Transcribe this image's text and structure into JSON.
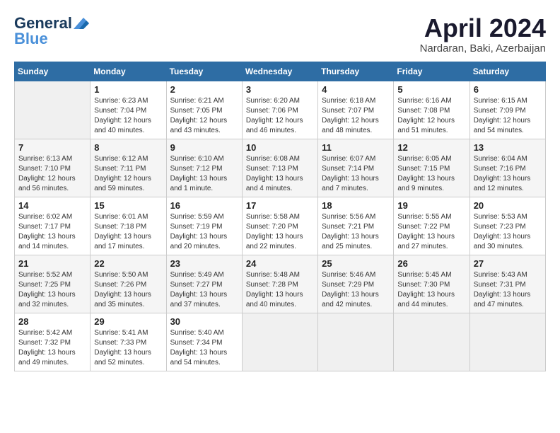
{
  "logo": {
    "line1": "General",
    "line2": "Blue"
  },
  "title": "April 2024",
  "location": "Nardaran, Baki, Azerbaijan",
  "days_of_week": [
    "Sunday",
    "Monday",
    "Tuesday",
    "Wednesday",
    "Thursday",
    "Friday",
    "Saturday"
  ],
  "weeks": [
    [
      {
        "day": "",
        "sunrise": "",
        "sunset": "",
        "daylight": ""
      },
      {
        "day": "1",
        "sunrise": "Sunrise: 6:23 AM",
        "sunset": "Sunset: 7:04 PM",
        "daylight": "Daylight: 12 hours and 40 minutes."
      },
      {
        "day": "2",
        "sunrise": "Sunrise: 6:21 AM",
        "sunset": "Sunset: 7:05 PM",
        "daylight": "Daylight: 12 hours and 43 minutes."
      },
      {
        "day": "3",
        "sunrise": "Sunrise: 6:20 AM",
        "sunset": "Sunset: 7:06 PM",
        "daylight": "Daylight: 12 hours and 46 minutes."
      },
      {
        "day": "4",
        "sunrise": "Sunrise: 6:18 AM",
        "sunset": "Sunset: 7:07 PM",
        "daylight": "Daylight: 12 hours and 48 minutes."
      },
      {
        "day": "5",
        "sunrise": "Sunrise: 6:16 AM",
        "sunset": "Sunset: 7:08 PM",
        "daylight": "Daylight: 12 hours and 51 minutes."
      },
      {
        "day": "6",
        "sunrise": "Sunrise: 6:15 AM",
        "sunset": "Sunset: 7:09 PM",
        "daylight": "Daylight: 12 hours and 54 minutes."
      }
    ],
    [
      {
        "day": "7",
        "sunrise": "Sunrise: 6:13 AM",
        "sunset": "Sunset: 7:10 PM",
        "daylight": "Daylight: 12 hours and 56 minutes."
      },
      {
        "day": "8",
        "sunrise": "Sunrise: 6:12 AM",
        "sunset": "Sunset: 7:11 PM",
        "daylight": "Daylight: 12 hours and 59 minutes."
      },
      {
        "day": "9",
        "sunrise": "Sunrise: 6:10 AM",
        "sunset": "Sunset: 7:12 PM",
        "daylight": "Daylight: 13 hours and 1 minute."
      },
      {
        "day": "10",
        "sunrise": "Sunrise: 6:08 AM",
        "sunset": "Sunset: 7:13 PM",
        "daylight": "Daylight: 13 hours and 4 minutes."
      },
      {
        "day": "11",
        "sunrise": "Sunrise: 6:07 AM",
        "sunset": "Sunset: 7:14 PM",
        "daylight": "Daylight: 13 hours and 7 minutes."
      },
      {
        "day": "12",
        "sunrise": "Sunrise: 6:05 AM",
        "sunset": "Sunset: 7:15 PM",
        "daylight": "Daylight: 13 hours and 9 minutes."
      },
      {
        "day": "13",
        "sunrise": "Sunrise: 6:04 AM",
        "sunset": "Sunset: 7:16 PM",
        "daylight": "Daylight: 13 hours and 12 minutes."
      }
    ],
    [
      {
        "day": "14",
        "sunrise": "Sunrise: 6:02 AM",
        "sunset": "Sunset: 7:17 PM",
        "daylight": "Daylight: 13 hours and 14 minutes."
      },
      {
        "day": "15",
        "sunrise": "Sunrise: 6:01 AM",
        "sunset": "Sunset: 7:18 PM",
        "daylight": "Daylight: 13 hours and 17 minutes."
      },
      {
        "day": "16",
        "sunrise": "Sunrise: 5:59 AM",
        "sunset": "Sunset: 7:19 PM",
        "daylight": "Daylight: 13 hours and 20 minutes."
      },
      {
        "day": "17",
        "sunrise": "Sunrise: 5:58 AM",
        "sunset": "Sunset: 7:20 PM",
        "daylight": "Daylight: 13 hours and 22 minutes."
      },
      {
        "day": "18",
        "sunrise": "Sunrise: 5:56 AM",
        "sunset": "Sunset: 7:21 PM",
        "daylight": "Daylight: 13 hours and 25 minutes."
      },
      {
        "day": "19",
        "sunrise": "Sunrise: 5:55 AM",
        "sunset": "Sunset: 7:22 PM",
        "daylight": "Daylight: 13 hours and 27 minutes."
      },
      {
        "day": "20",
        "sunrise": "Sunrise: 5:53 AM",
        "sunset": "Sunset: 7:23 PM",
        "daylight": "Daylight: 13 hours and 30 minutes."
      }
    ],
    [
      {
        "day": "21",
        "sunrise": "Sunrise: 5:52 AM",
        "sunset": "Sunset: 7:25 PM",
        "daylight": "Daylight: 13 hours and 32 minutes."
      },
      {
        "day": "22",
        "sunrise": "Sunrise: 5:50 AM",
        "sunset": "Sunset: 7:26 PM",
        "daylight": "Daylight: 13 hours and 35 minutes."
      },
      {
        "day": "23",
        "sunrise": "Sunrise: 5:49 AM",
        "sunset": "Sunset: 7:27 PM",
        "daylight": "Daylight: 13 hours and 37 minutes."
      },
      {
        "day": "24",
        "sunrise": "Sunrise: 5:48 AM",
        "sunset": "Sunset: 7:28 PM",
        "daylight": "Daylight: 13 hours and 40 minutes."
      },
      {
        "day": "25",
        "sunrise": "Sunrise: 5:46 AM",
        "sunset": "Sunset: 7:29 PM",
        "daylight": "Daylight: 13 hours and 42 minutes."
      },
      {
        "day": "26",
        "sunrise": "Sunrise: 5:45 AM",
        "sunset": "Sunset: 7:30 PM",
        "daylight": "Daylight: 13 hours and 44 minutes."
      },
      {
        "day": "27",
        "sunrise": "Sunrise: 5:43 AM",
        "sunset": "Sunset: 7:31 PM",
        "daylight": "Daylight: 13 hours and 47 minutes."
      }
    ],
    [
      {
        "day": "28",
        "sunrise": "Sunrise: 5:42 AM",
        "sunset": "Sunset: 7:32 PM",
        "daylight": "Daylight: 13 hours and 49 minutes."
      },
      {
        "day": "29",
        "sunrise": "Sunrise: 5:41 AM",
        "sunset": "Sunset: 7:33 PM",
        "daylight": "Daylight: 13 hours and 52 minutes."
      },
      {
        "day": "30",
        "sunrise": "Sunrise: 5:40 AM",
        "sunset": "Sunset: 7:34 PM",
        "daylight": "Daylight: 13 hours and 54 minutes."
      },
      {
        "day": "",
        "sunrise": "",
        "sunset": "",
        "daylight": ""
      },
      {
        "day": "",
        "sunrise": "",
        "sunset": "",
        "daylight": ""
      },
      {
        "day": "",
        "sunrise": "",
        "sunset": "",
        "daylight": ""
      },
      {
        "day": "",
        "sunrise": "",
        "sunset": "",
        "daylight": ""
      }
    ]
  ]
}
